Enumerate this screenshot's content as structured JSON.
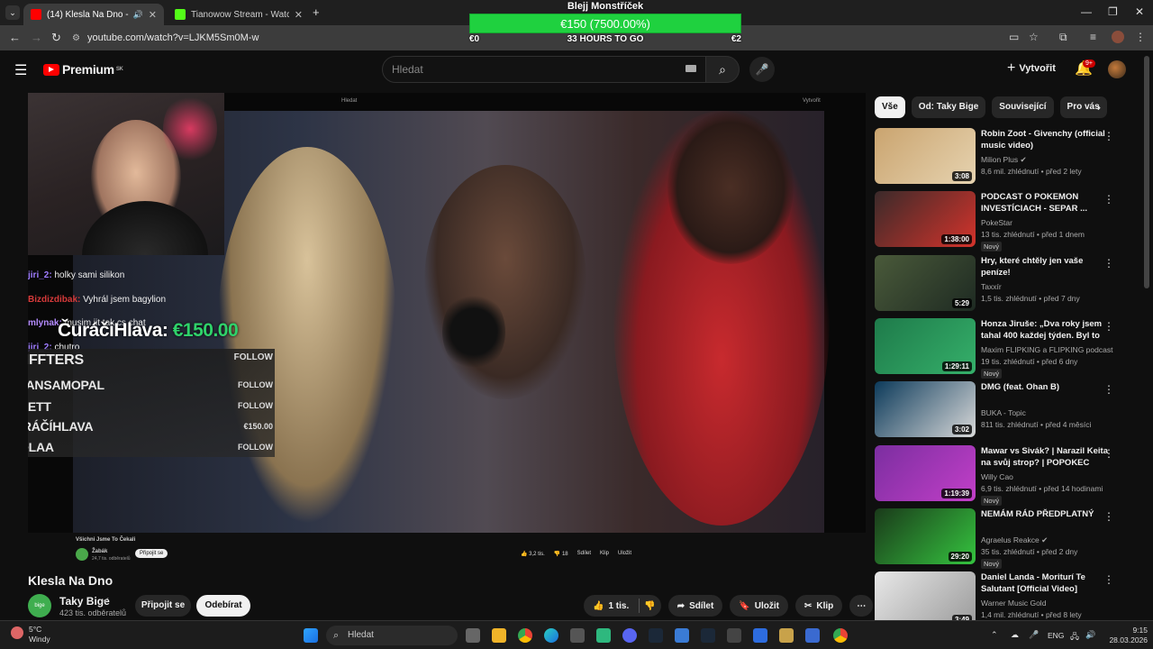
{
  "browser": {
    "tabs": [
      {
        "title": "(14) Klesla Na Dno - YouTube",
        "icon": "youtube-favicon-icon",
        "color": "#ff0000"
      },
      {
        "title": "Tianowow Stream - Watch Live",
        "icon": "kick-favicon-icon",
        "color": "#53fc18"
      }
    ],
    "url": "youtube.com/watch?v=LJKM5Sm0M-w"
  },
  "overlay": {
    "title": "Blejj Monstříček",
    "goal_text": "€150 (7500.00%)",
    "min": "€0",
    "max": "€2",
    "hours_left": "33 HOURS TO GO",
    "progress_fraction": 1.0
  },
  "yt": {
    "logo_text": "Premium",
    "logo_sup": "SK",
    "search_placeholder": "Hledat",
    "create_label": "Vytvořit",
    "notif_badge": "9+"
  },
  "video": {
    "title": "Klesla Na Dno",
    "channel": "Taky Bige",
    "subscribers": "423 tis. odběratelů",
    "avatar_text": "bige",
    "join_label": "Připojit se",
    "subscribe_label": "Odebírat",
    "likes": "1 tis.",
    "share_label": "Sdílet",
    "save_label": "Uložit",
    "clip_label": "Klip"
  },
  "stream": {
    "chat": [
      {
        "user": "jiri_2:",
        "msg": "holky sami silikon",
        "color": "#9e7cff"
      },
      {
        "user": "Bizdizdibak:",
        "msg": "Vyhrál jsem bagylion",
        "color": "#d63a3a"
      },
      {
        "user": "mlynak:",
        "msg": "musim jit tak cs chat",
        "color": "#b48bff"
      },
      {
        "user": "jiri_2:",
        "msg": "chutro",
        "color": "#9e7cff"
      }
    ],
    "donation_name": "ČuráčiHlava:",
    "donation_amount": "€150.00",
    "followers": [
      {
        "name": "DRIFFTERS",
        "right": "FOLLOW"
      },
      {
        "name": "MILANSAMOPAL",
        "right": "FOLLOW"
      },
      {
        "name": "WAIETT",
        "right": "FOLLOW"
      },
      {
        "name": "ČŮRÁČÍHLAVA",
        "right": "€150.00"
      },
      {
        "name": "JEDLAA",
        "right": "FOLLOW"
      }
    ],
    "inner_search": "Hledat",
    "inner_create": "Vytvořit",
    "inner_title": "Všichni Jsme To Čekali",
    "inner_channel": "Žabák",
    "inner_subs": "24,7 tis. odběratelů",
    "inner_join": "Připojit se",
    "inner_likes": "3,2 tis.",
    "inner_dislikes": "18",
    "inner_share": "Sdílet",
    "inner_clip": "Klip",
    "inner_save": "Uložit"
  },
  "chips": [
    "Vše",
    "Od: Taky Bige",
    "Související",
    "Pro vás"
  ],
  "recs": [
    {
      "title": "Robin Zoot - Givenchy (official music video)",
      "channel": "Milion Plus",
      "verified": true,
      "meta": "8,6 mil. zhlédnutí • před 2 lety",
      "duration": "3:08",
      "new": "",
      "c1": "#caa46f",
      "c2": "#e6d3b0"
    },
    {
      "title": "PODCAST O POKEMON INVESTÍCIACH - SEPAR ...",
      "channel": "PokeStar",
      "verified": false,
      "meta": "13 tis. zhlédnutí • před 1 dnem",
      "duration": "1:38:00",
      "new": "Nový",
      "c1": "#3a2a2a",
      "c2": "#d4332b"
    },
    {
      "title": "Hry, které chtěly jen vaše peníze!",
      "channel": "Taxxír",
      "verified": false,
      "meta": "1,5 tis. zhlédnutí • před 7 dny",
      "duration": "5:29",
      "new": "",
      "c1": "#4a5a3a",
      "c2": "#1e2a22"
    },
    {
      "title": "Honza Jiruše: „Dva roky jsem tahal 400 každej týden. Byl to ...",
      "channel": "Maxim FLIPKING a FLIPKING podcast",
      "verified": false,
      "meta": "19 tis. zhlédnutí • před 6 dny",
      "duration": "1:29:11",
      "new": "Nový",
      "c1": "#1e7a4a",
      "c2": "#35b06a"
    },
    {
      "title": "DMG (feat. Ohan B)",
      "channel": "BUKA - Topic",
      "verified": false,
      "meta": "811 tis. zhlédnutí • před 4 měsíci",
      "duration": "3:02",
      "new": "",
      "c1": "#0c3a5a",
      "c2": "#d9d9d9"
    },
    {
      "title": "Mawar vs Sivák? | Narazil Keita na svůj strop? | POPOKEC",
      "channel": "Willy Cao",
      "verified": false,
      "meta": "6,9 tis. zhlédnutí • před 14 hodinami",
      "duration": "1:19:39",
      "new": "Nový",
      "c1": "#7b2ea0",
      "c2": "#c23fc8"
    },
    {
      "title": "NEMÁM RÁD PŘEDPLATNÝ",
      "channel": "Agraelus Reakce",
      "verified": true,
      "meta": "35 tis. zhlédnutí • před 2 dny",
      "duration": "29:20",
      "new": "Nový",
      "c1": "#1a3a1a",
      "c2": "#35c43f"
    },
    {
      "title": "Daniel Landa - Moriturí Te Salutant [Official Video]",
      "channel": "Warner Music Gold",
      "verified": false,
      "meta": "1,4 mil. zhlédnutí • před 8 lety",
      "duration": "3:49",
      "new": "",
      "c1": "#e8e8e8",
      "c2": "#9a9a9a"
    }
  ],
  "taskbar": {
    "temp": "5°C",
    "weather": "Windy",
    "search": "Hledat",
    "lang": "ENG",
    "time": "9:15",
    "date": "28.03.2026"
  }
}
